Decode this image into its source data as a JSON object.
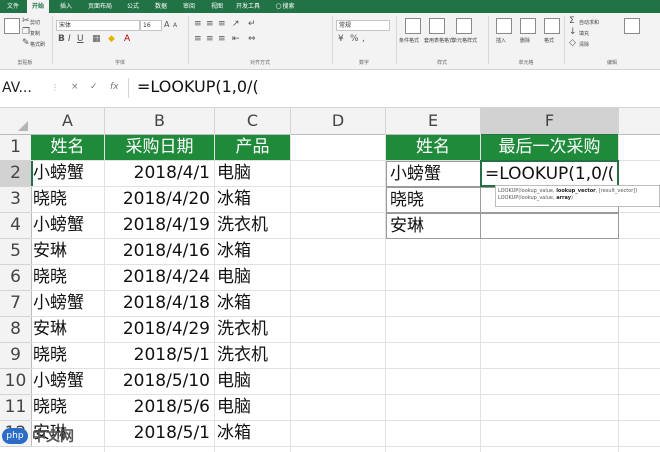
{
  "ribbon": {
    "tabs": [
      "文件",
      "开始",
      "插入",
      "页面布局",
      "公式",
      "数据",
      "审阅",
      "视图",
      "开发工具",
      "搜索"
    ],
    "active_tab": "开始",
    "font_name": "宋体",
    "font_size": "16",
    "groups": [
      "剪贴板",
      "字体",
      "对齐方式",
      "数字",
      "样式",
      "单元格",
      "编辑"
    ],
    "clipboard": {
      "cut": "剪切",
      "copy": "复制",
      "format_painter": "格式刷"
    },
    "number_format": "常规",
    "styles": {
      "conditional": "条件格式",
      "table": "套用表格格式",
      "cell_styles": "单元格样式"
    },
    "cells": {
      "insert": "插入",
      "delete": "删除",
      "format": "格式"
    },
    "editing": {
      "autosum": "自动求和",
      "fill": "填充",
      "clear": "清除"
    }
  },
  "formula_bar": {
    "name_box": "AV...",
    "cancel": "×",
    "enter": "✓",
    "fx": "fx",
    "formula": "=LOOKUP(1,0/("
  },
  "columns": [
    "A",
    "B",
    "C",
    "D",
    "E",
    "F"
  ],
  "rows": [
    "1",
    "2",
    "3",
    "4",
    "5",
    "6",
    "7",
    "8",
    "9",
    "10",
    "11",
    "12"
  ],
  "table1": {
    "headers": [
      "姓名",
      "采购日期",
      "产品"
    ],
    "rows": [
      [
        "小螃蟹",
        "2018/4/1",
        "电脑"
      ],
      [
        "晓晓",
        "2018/4/20",
        "冰箱"
      ],
      [
        "小螃蟹",
        "2018/4/19",
        "洗衣机"
      ],
      [
        "安琳",
        "2018/4/16",
        "冰箱"
      ],
      [
        "晓晓",
        "2018/4/24",
        "电脑"
      ],
      [
        "小螃蟹",
        "2018/4/18",
        "冰箱"
      ],
      [
        "安琳",
        "2018/4/29",
        "洗衣机"
      ],
      [
        "晓晓",
        "2018/5/1",
        "洗衣机"
      ],
      [
        "小螃蟹",
        "2018/5/10",
        "电脑"
      ],
      [
        "晓晓",
        "2018/5/6",
        "电脑"
      ],
      [
        "安琳",
        "2018/5/1",
        "冰箱"
      ]
    ]
  },
  "table2": {
    "headers": [
      "姓名",
      "最后一次采购"
    ],
    "names": [
      "小螃蟹",
      "晓晓",
      "安琳"
    ],
    "editing_cell": "=LOOKUP(1,0/("
  },
  "tooltip": {
    "line1_prefix": "LOOKUP(lookup_value,",
    "line1_bold": "lookup_vector",
    "line1_suffix": ", [result_vector])",
    "line2_prefix": "LOOKUP(lookup_value,",
    "line2_bold": "array",
    "line2_suffix": ")"
  },
  "watermark": {
    "logo": "php",
    "text": "中文网"
  }
}
